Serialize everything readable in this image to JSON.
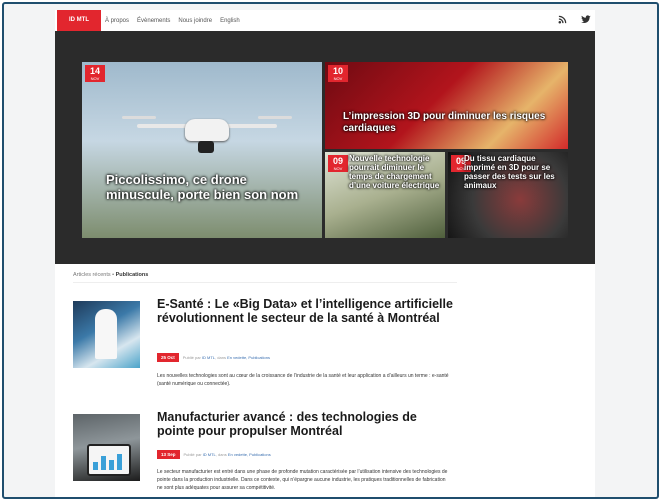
{
  "nav": {
    "brand": "ID MTL",
    "links": [
      "À propos",
      "Évènements",
      "Nous joindre",
      "English"
    ],
    "rss_icon": "rss-icon",
    "twitter_icon": "twitter-icon"
  },
  "hero": {
    "tiles": [
      {
        "day": "14",
        "month": "NOV",
        "title": "Piccolissimo, ce drone minuscule, porte bien son nom"
      },
      {
        "day": "10",
        "month": "NOV",
        "title": "L’impression 3D pour diminuer les risques cardiaques"
      },
      {
        "day": "09",
        "month": "NOV",
        "title": "Nouvelle technologie pourrait diminuer le temps de chargement d’une voiture électrique"
      },
      {
        "day": "09",
        "month": "NOV",
        "title": "Du tissu cardiaque imprimé en 3D pour se passer des tests sur les animaux"
      }
    ]
  },
  "breadcrumb": {
    "parent": "Articles récents",
    "separator": " • ",
    "current": "Publications"
  },
  "articles": [
    {
      "title": "E-Santé : Le «Big Data» et l’intelligence artificielle révolutionnent le secteur de la santé à Montréal",
      "date": "25 Oct",
      "published_by": "Publié par",
      "author": "ID MTL",
      "in_label": "dans",
      "categories": "En vedette, Publications",
      "excerpt": "Les nouvelles technologies sont au cœur de la croissance de l’industrie de la santé et leur application a d’ailleurs un terme : e-santé (santé numérique ou connectée)."
    },
    {
      "title": "Manufacturier avancé : des technologies de pointe pour propulser Montréal",
      "date": "13 Sep",
      "published_by": "Publié par",
      "author": "ID MTL",
      "in_label": "dans",
      "categories": "En vedette, Publications",
      "excerpt": "Le secteur manufacturier est entré dans une phase de profonde mutation caractérisée par l’utilisation intensive des technologies de pointe dans la production industrielle. Dans ce contexte, qui n’épargne aucune industrie, les pratiques traditionnelles de fabrication ne sont plus adéquates pour assurer sa compétitivité."
    }
  ],
  "colors": {
    "accent": "#e2262e",
    "hero_bg": "#2b2b2b",
    "frame_border": "#1f4e6e"
  }
}
